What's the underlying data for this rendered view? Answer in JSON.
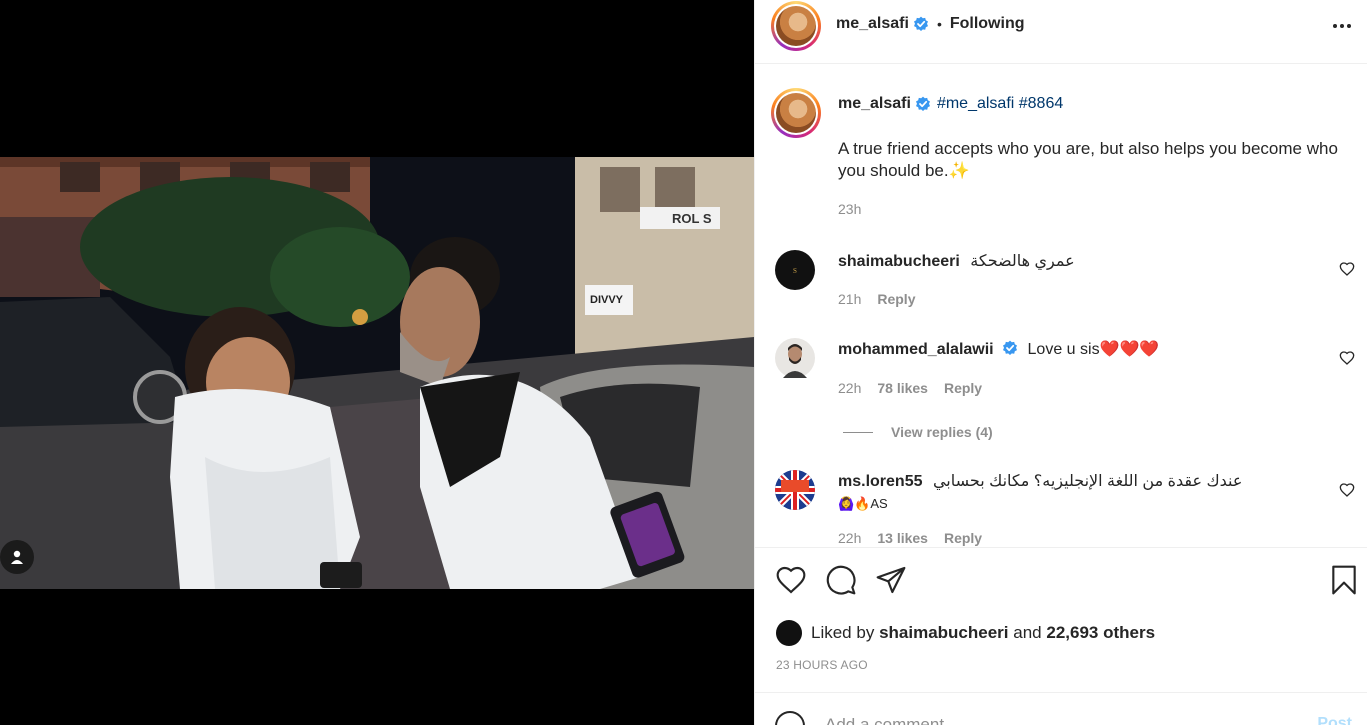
{
  "header": {
    "username": "me_alsafi",
    "dot": "•",
    "follow_status": "Following"
  },
  "caption": {
    "username": "me_alsafi",
    "hashtags": "#me_alsafi #8864",
    "text": "A true friend accepts who you are, but also helps you become who you should be.✨",
    "time": "23h"
  },
  "comments": [
    {
      "username": "shaimabucheeri",
      "text": "عمري هالضحكة",
      "time": "21h",
      "likes": "",
      "reply": "Reply",
      "avatar_color": "#111111"
    },
    {
      "username": "mohammed_alalawii",
      "text": "Love u sis❤️❤️❤️",
      "time": "22h",
      "likes": "78 likes",
      "reply": "Reply",
      "verified": true,
      "avatar_color": "#e8e6e3"
    },
    {
      "username": "ms.loren55",
      "text": "عندك عقدة من اللغة الإنجليزيه؟ مكانك بحسابي",
      "text_line2": "🙆‍♀️🔥AS",
      "time": "22h",
      "likes": "13 likes",
      "reply": "Reply",
      "avatar_color": "#1d3c8f"
    }
  ],
  "view_replies": "View replies (4)",
  "likes": {
    "prefix": "Liked by",
    "user": "shaimabucheeri",
    "and": "and",
    "others": "22,693 others"
  },
  "post_time": "23 HOURS AGO",
  "add_comment": {
    "placeholder": "Add a comment...",
    "post_label": "Post"
  },
  "colors": {
    "link": "#00376b",
    "verified": "#3897f0",
    "heart": "#ed4956",
    "muted": "#8e8e8e",
    "post_button": "#b2dffc"
  },
  "icons": [
    "verified-icon",
    "more-options-icon",
    "heart-icon",
    "comment-icon",
    "share-icon",
    "bookmark-icon",
    "user-tag-icon",
    "emoji-icon"
  ]
}
